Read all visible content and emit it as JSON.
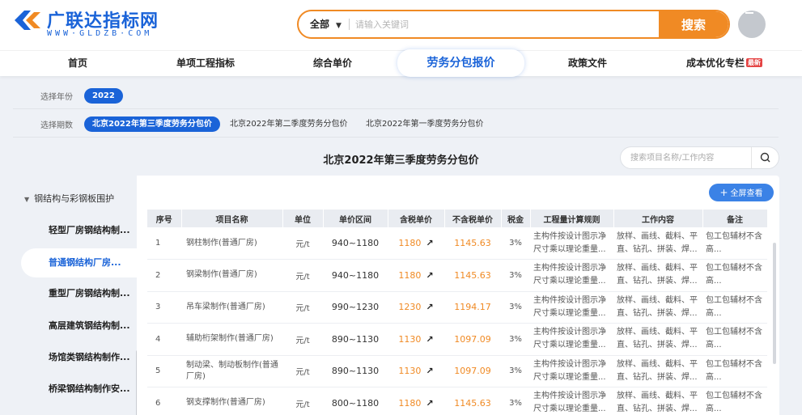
{
  "brand": {
    "name": "广联达指标网",
    "url_text": "WWW·GLDZB·COM"
  },
  "search": {
    "scope": "全部",
    "placeholder": "请输入关键词",
    "button": "搜索"
  },
  "nav": [
    {
      "label": "首页"
    },
    {
      "label": "单项工程指标"
    },
    {
      "label": "综合单价"
    },
    {
      "label": "劳务分包报价",
      "active": true
    },
    {
      "label": "政策文件"
    },
    {
      "label": "成本优化专栏",
      "badge": "最新"
    }
  ],
  "filters": {
    "year": {
      "label": "选择年份",
      "options": [
        "2022"
      ],
      "selected": "2022"
    },
    "period": {
      "label": "选择期数",
      "options": [
        "北京2022年第三季度劳务分包价",
        "北京2022年第二季度劳务分包价",
        "北京2022年第一季度劳务分包价"
      ],
      "selected": "北京2022年第三季度劳务分包价"
    }
  },
  "page_title": "北京2022年第三季度劳务分包价",
  "side_search_placeholder": "搜索项目名称/工作内容",
  "sidebar": {
    "group": "钢结构与彩钢板围护",
    "items": [
      {
        "label": "轻型厂房钢结构制..."
      },
      {
        "label": "普通钢结构厂房...",
        "active": true
      },
      {
        "label": "重型厂房钢结构制..."
      },
      {
        "label": "高层建筑钢结构制..."
      },
      {
        "label": "场馆类钢结构制作..."
      },
      {
        "label": "桥梁钢结构制作安..."
      }
    ]
  },
  "fullscreen_label": "全屏查看",
  "table": {
    "headers": [
      "序号",
      "项目名称",
      "单位",
      "单价区间",
      "含税单价",
      "不含税单价",
      "税金",
      "工程量计算规则",
      "工作内容",
      "备注"
    ],
    "rows": [
      {
        "no": "1",
        "name": "钢柱制作(普通厂房)",
        "unit": "元/t",
        "range": "940~1180",
        "tax_price": "1180",
        "notax_price": "1145.63",
        "tax": "3%",
        "rule": "主构件按设计图示净尺寸乘以理论重量...",
        "work": "放样、画线、截料、平直、钻孔、拼装、焊...",
        "note": "包工包辅材不含高..."
      },
      {
        "no": "2",
        "name": "钢梁制作(普通厂房)",
        "unit": "元/t",
        "range": "940~1180",
        "tax_price": "1180",
        "notax_price": "1145.63",
        "tax": "3%",
        "rule": "主构件按设计图示净尺寸乘以理论重量...",
        "work": "放样、画线、截料、平直、钻孔、拼装、焊...",
        "note": "包工包辅材不含高..."
      },
      {
        "no": "3",
        "name": "吊车梁制作(普通厂房)",
        "unit": "元/t",
        "range": "990~1230",
        "tax_price": "1230",
        "notax_price": "1194.17",
        "tax": "3%",
        "rule": "主构件按设计图示净尺寸乘以理论重量...",
        "work": "放样、画线、截料、平直、钻孔、拼装、焊...",
        "note": "包工包辅材不含高..."
      },
      {
        "no": "4",
        "name": "辅助桁架制作(普通厂房)",
        "unit": "元/t",
        "range": "890~1130",
        "tax_price": "1130",
        "notax_price": "1097.09",
        "tax": "3%",
        "rule": "主构件按设计图示净尺寸乘以理论重量...",
        "work": "放样、画线、截料、平直、钻孔、拼装、焊...",
        "note": "包工包辅材不含高..."
      },
      {
        "no": "5",
        "name": "制动梁、制动板制作(普通厂房)",
        "unit": "元/t",
        "range": "890~1130",
        "tax_price": "1130",
        "notax_price": "1097.09",
        "tax": "3%",
        "rule": "主构件按设计图示净尺寸乘以理论重量...",
        "work": "放样、画线、截料、平直、钻孔、拼装、焊...",
        "note": "包工包辅材不含高..."
      },
      {
        "no": "6",
        "name": "钢支撑制作(普通厂房)",
        "unit": "元/t",
        "range": "800~1180",
        "tax_price": "1180",
        "notax_price": "1145.63",
        "tax": "3%",
        "rule": "主构件按设计图示净尺寸乘以理论重量...",
        "work": "放样、画线、截料、平直、钻孔、拼装、焊...",
        "note": "包工包辅材不含高..."
      }
    ]
  },
  "colors": {
    "primary": "#1a63d8",
    "accent": "#f08a24"
  }
}
